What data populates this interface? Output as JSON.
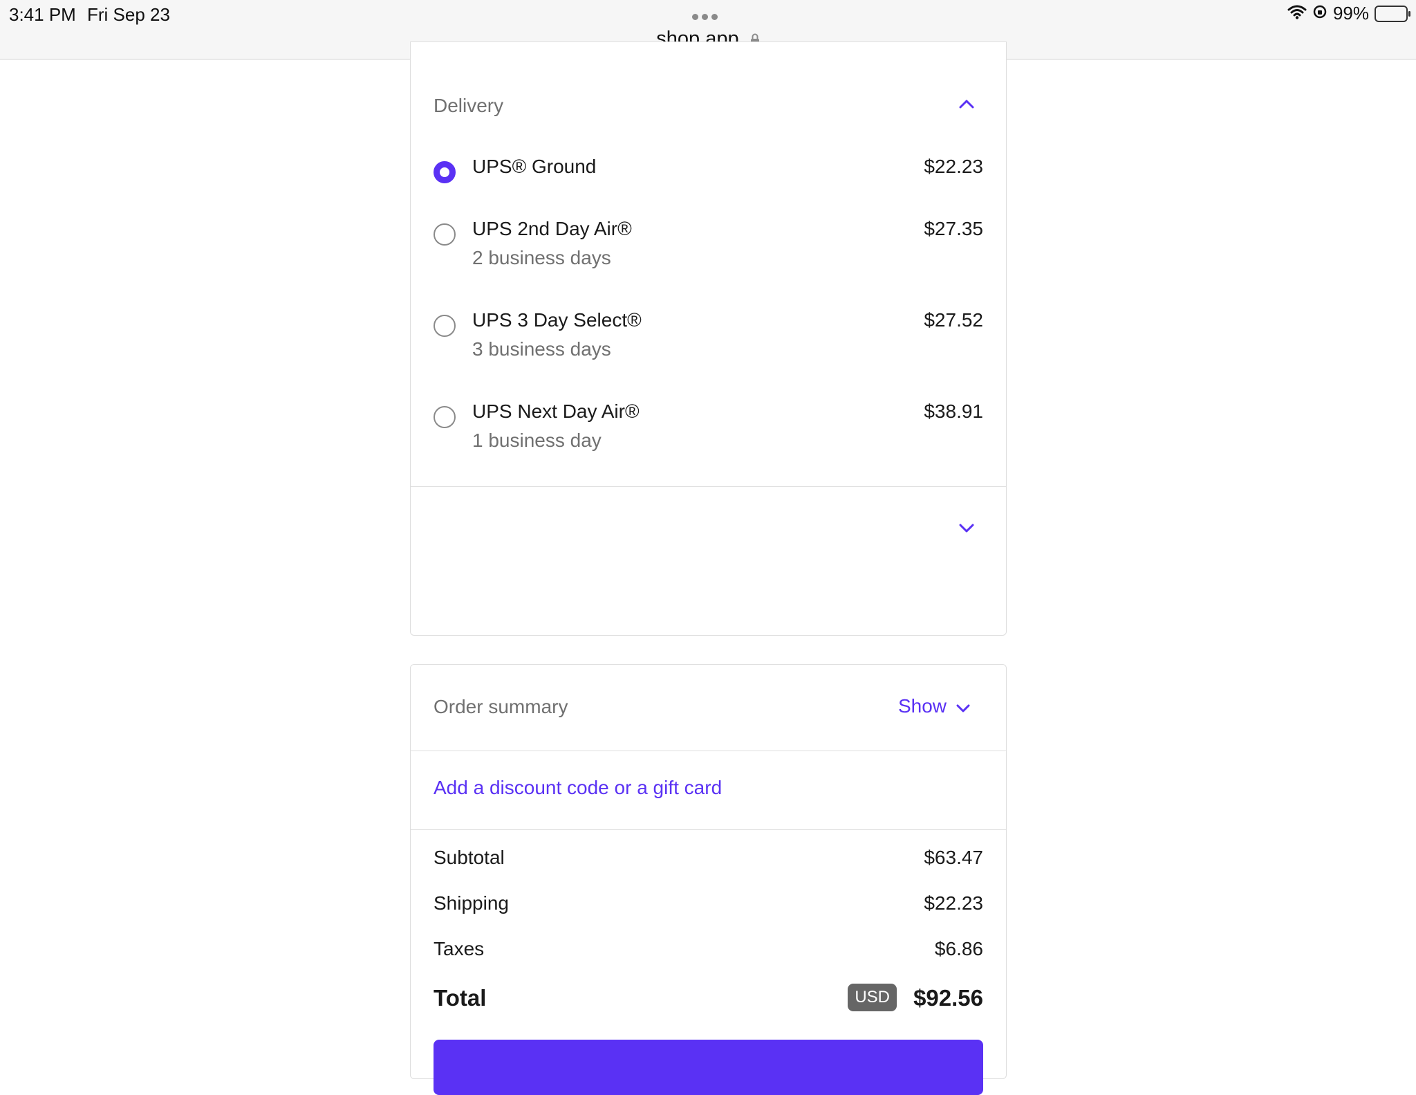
{
  "status_bar": {
    "time": "3:41 PM",
    "date": "Fri Sep 23",
    "battery": "99%",
    "url": "shop.app"
  },
  "delivery": {
    "title": "Delivery",
    "options": [
      {
        "name": "UPS® Ground",
        "sub": "",
        "price": "$22.23",
        "selected": true
      },
      {
        "name": "UPS 2nd Day Air®",
        "sub": "2 business days",
        "price": "$27.35",
        "selected": false
      },
      {
        "name": "UPS 3 Day Select®",
        "sub": "3 business days",
        "price": "$27.52",
        "selected": false
      },
      {
        "name": "UPS Next Day Air®",
        "sub": "1 business day",
        "price": "$38.91",
        "selected": false
      }
    ]
  },
  "summary": {
    "title": "Order summary",
    "show_label": "Show",
    "discount_link": "Add a discount code or a gift card",
    "subtotal_label": "Subtotal",
    "subtotal_value": "$63.47",
    "shipping_label": "Shipping",
    "shipping_value": "$22.23",
    "taxes_label": "Taxes",
    "taxes_value": "$6.86",
    "total_label": "Total",
    "currency": "USD",
    "total_value": "$92.56"
  },
  "colors": {
    "accent": "#5a31f4",
    "muted_text": "#707070",
    "border": "#dedede"
  }
}
